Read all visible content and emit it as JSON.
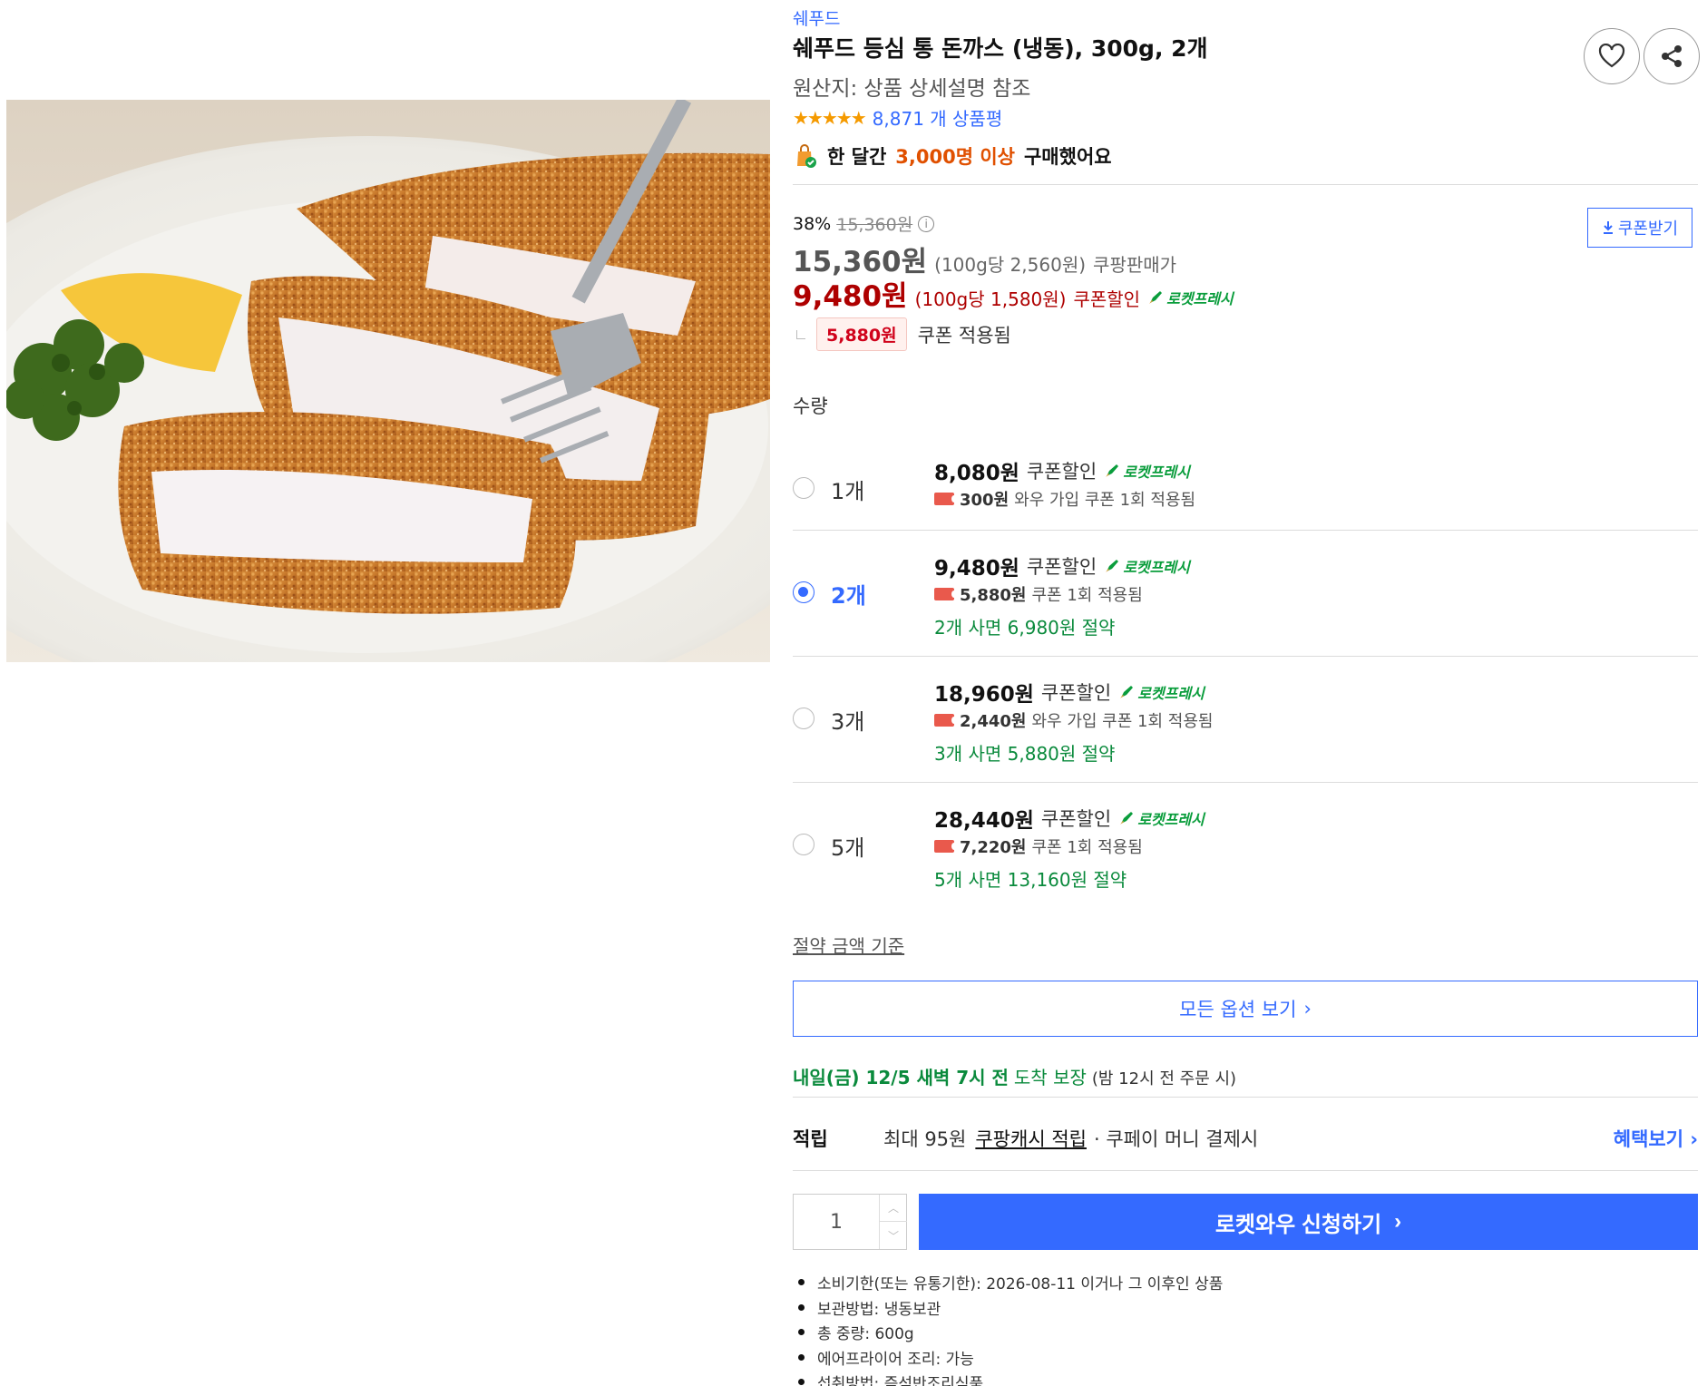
{
  "product": {
    "brand": "쉐푸드",
    "title": "쉐푸드 등심 통 돈까스 (냉동), 300g, 2개",
    "origin": "원산지: 상품 상세설명 참조",
    "rating_stars": "★★★★★",
    "review_count": "8,871 개 상품평",
    "sales_prefix": "한 달간",
    "sales_highlight": "3,000명 이상",
    "sales_suffix": "구매했어요"
  },
  "pricing": {
    "discount_rate": "38%",
    "original_price": "15,360원",
    "sale_price": "15,360원",
    "sale_unit": "(100g당 2,560원)",
    "sale_label": "쿠팡판매가",
    "coupon_price": "9,480원",
    "coupon_unit": "(100g당 1,580원)",
    "coupon_label": "쿠폰할인",
    "rocket_label": "로켓프레시",
    "applied_amount": "5,880원",
    "applied_text": "쿠폰 적용됨",
    "coupon_button": "쿠폰받기"
  },
  "quantity": {
    "label": "수량",
    "options": [
      {
        "qty": "1개",
        "price": "8,080원",
        "label": "쿠폰할인",
        "rocket": "로켓프레시",
        "coupon_amount": "300원",
        "coupon_text": "와우 가입 쿠폰 1회 적용됨",
        "save": "",
        "selected": false
      },
      {
        "qty": "2개",
        "price": "9,480원",
        "label": "쿠폰할인",
        "rocket": "로켓프레시",
        "coupon_amount": "5,880원",
        "coupon_text": "쿠폰 1회 적용됨",
        "save": "2개 사면 6,980원 절약",
        "selected": true
      },
      {
        "qty": "3개",
        "price": "18,960원",
        "label": "쿠폰할인",
        "rocket": "로켓프레시",
        "coupon_amount": "2,440원",
        "coupon_text": "와우 가입 쿠폰 1회 적용됨",
        "save": "3개 사면 5,880원 절약",
        "selected": false
      },
      {
        "qty": "5개",
        "price": "28,440원",
        "label": "쿠폰할인",
        "rocket": "로켓프레시",
        "coupon_amount": "7,220원",
        "coupon_text": "쿠폰 1회 적용됨",
        "save": "5개 사면 13,160원 절약",
        "selected": false
      }
    ],
    "criteria_link": "절약 금액 기준",
    "all_options_button": "모든 옵션 보기"
  },
  "delivery": {
    "date": "내일(금) 12/5 새벽 7시 전",
    "arrive": "도착 보장",
    "condition": "(밤 12시 전 주문 시)"
  },
  "points": {
    "label": "적립",
    "max": "최대 95원",
    "link": "쿠팡캐시 적립",
    "rest": "· 쿠페이 머니 결제시",
    "benefit_link": "혜택보기"
  },
  "purchase": {
    "quantity_value": "1",
    "button_label": "로켓와우 신청하기"
  },
  "notes": [
    "소비기한(또는 유통기한): 2026-08-11 이거나 그 이후인 상품",
    "보관방법: 냉동보관",
    "총 중량: 600g",
    "에어프라이어 조리: 가능",
    "섭취방법: 즉석반조리식품"
  ],
  "colors": {
    "accent": "#346aff",
    "coupon_red": "#ae0000",
    "rocket_green": "#0a9d3c",
    "save_green": "#0a8a3c"
  }
}
